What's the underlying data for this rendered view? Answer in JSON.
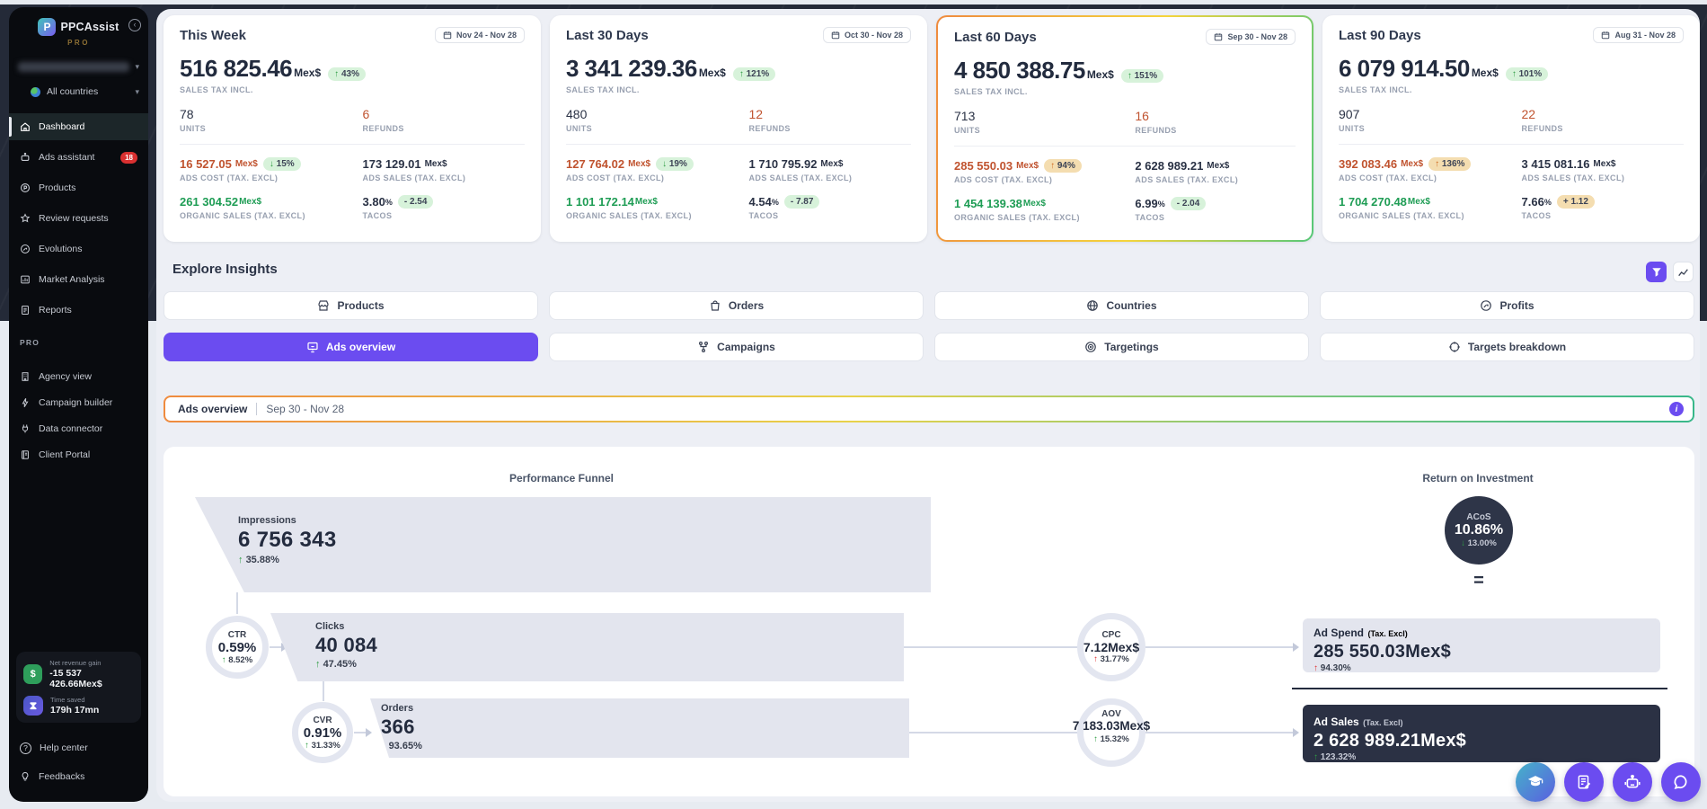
{
  "colors": {
    "accent": "#6b4cf0",
    "good_green": "#2f9e44",
    "bad_red": "#e03131",
    "rust": "#c0532f",
    "green_value": "#1f9d55",
    "dark_navy": "#2b3346",
    "badge_green_bg": "#d7f2da",
    "badge_orange_bg": "#f4ddb0",
    "sidebar_bg": "#090b0f",
    "top_band_bg": "#242a38"
  },
  "sidebar": {
    "brand": "PPCAssist",
    "tier": "PRO",
    "country": "All countries",
    "menu": [
      {
        "label": "Dashboard"
      },
      {
        "label": "Ads assistant",
        "badge": "18"
      },
      {
        "label": "Products"
      },
      {
        "label": "Review requests"
      },
      {
        "label": "Evolutions"
      },
      {
        "label": "Market Analysis"
      },
      {
        "label": "Reports"
      }
    ],
    "section_label": "PRO",
    "pro_menu": [
      {
        "label": "Agency view"
      },
      {
        "label": "Campaign builder"
      },
      {
        "label": "Data connector"
      },
      {
        "label": "Client Portal"
      }
    ],
    "stats": [
      {
        "label": "Net revenue gain",
        "value": "-15 537 426.66Mex$"
      },
      {
        "label": "Time saved",
        "value": "179h 17mn"
      }
    ],
    "footer": [
      {
        "label": "Help center"
      },
      {
        "label": "Feedbacks"
      }
    ]
  },
  "cards": [
    {
      "title": "This Week",
      "range": "Nov 24 - Nov 28",
      "total": {
        "value": "516 825.46",
        "currency": "Mex$",
        "badge_arrow": "↑",
        "badge_text": "43%"
      },
      "total_label": "SALES TAX INCL.",
      "units": {
        "value": "78",
        "label": "UNITS"
      },
      "refunds": {
        "value": "6",
        "label": "REFUNDS"
      },
      "ads_cost": {
        "value": "16 527.05",
        "currency": "Mex$",
        "badge_arrow": "↓",
        "badge_text": "15%",
        "label": "ADS COST (TAX. EXCL)"
      },
      "ads_sales": {
        "value": "173 129.01",
        "currency": "Mex$",
        "label": "ADS SALES (TAX. EXCL)"
      },
      "organic": {
        "value": "261 304.52",
        "currency": "Mex$",
        "label": "ORGANIC SALES (TAX. EXCL)"
      },
      "tacos": {
        "value": "3.80",
        "unit": "%",
        "badge_text": "- 2.54",
        "label": "TACOS"
      }
    },
    {
      "title": "Last 30 Days",
      "range": "Oct 30 - Nov 28",
      "total": {
        "value": "3 341 239.36",
        "currency": "Mex$",
        "badge_arrow": "↑",
        "badge_text": "121%"
      },
      "total_label": "SALES TAX INCL.",
      "units": {
        "value": "480",
        "label": "UNITS"
      },
      "refunds": {
        "value": "12",
        "label": "REFUNDS"
      },
      "ads_cost": {
        "value": "127 764.02",
        "currency": "Mex$",
        "badge_arrow": "↓",
        "badge_text": "19%",
        "label": "ADS COST (TAX. EXCL)"
      },
      "ads_sales": {
        "value": "1 710 795.92",
        "currency": "Mex$",
        "label": "ADS SALES (TAX. EXCL)"
      },
      "organic": {
        "value": "1 101 172.14",
        "currency": "Mex$",
        "label": "ORGANIC SALES (TAX. EXCL)"
      },
      "tacos": {
        "value": "4.54",
        "unit": "%",
        "badge_text": "- 7.87",
        "label": "TACOS"
      }
    },
    {
      "title": "Last 60 Days",
      "range": "Sep 30 - Nov 28",
      "total": {
        "value": "4 850 388.75",
        "currency": "Mex$",
        "badge_arrow": "↑",
        "badge_text": "151%"
      },
      "total_label": "SALES TAX INCL.",
      "units": {
        "value": "713",
        "label": "UNITS"
      },
      "refunds": {
        "value": "16",
        "label": "REFUNDS"
      },
      "ads_cost": {
        "value": "285 550.03",
        "currency": "Mex$",
        "badge_arrow": "↑",
        "badge_text": "94%",
        "label": "ADS COST (TAX. EXCL)"
      },
      "ads_sales": {
        "value": "2 628 989.21",
        "currency": "Mex$",
        "label": "ADS SALES (TAX. EXCL)"
      },
      "organic": {
        "value": "1 454 139.38",
        "currency": "Mex$",
        "label": "ORGANIC SALES (TAX. EXCL)"
      },
      "tacos": {
        "value": "6.99",
        "unit": "%",
        "badge_text": "- 2.04",
        "label": "TACOS"
      }
    },
    {
      "title": "Last 90 Days",
      "range": "Aug 31 - Nov 28",
      "total": {
        "value": "6 079 914.50",
        "currency": "Mex$",
        "badge_arrow": "↑",
        "badge_text": "101%"
      },
      "total_label": "SALES TAX INCL.",
      "units": {
        "value": "907",
        "label": "UNITS"
      },
      "refunds": {
        "value": "22",
        "label": "REFUNDS"
      },
      "ads_cost": {
        "value": "392 083.46",
        "currency": "Mex$",
        "badge_arrow": "↑",
        "badge_text": "136%",
        "label": "ADS COST (TAX. EXCL)"
      },
      "ads_sales": {
        "value": "3 415 081.16",
        "currency": "Mex$",
        "label": "ADS SALES (TAX. EXCL)"
      },
      "organic": {
        "value": "1 704 270.48",
        "currency": "Mex$",
        "label": "ORGANIC SALES (TAX. EXCL)"
      },
      "tacos": {
        "value": "7.66",
        "unit": "%",
        "badge_text": "+ 1.12",
        "label": "TACOS"
      }
    }
  ],
  "insights": {
    "title": "Explore Insights",
    "buttons": [
      {
        "label": "Products"
      },
      {
        "label": "Orders"
      },
      {
        "label": "Countries"
      },
      {
        "label": "Profits"
      },
      {
        "label": "Ads overview"
      },
      {
        "label": "Campaigns"
      },
      {
        "label": "Targetings"
      },
      {
        "label": "Targets breakdown"
      }
    ]
  },
  "overview_bar": {
    "title": "Ads overview",
    "range": "Sep 30 - Nov 28",
    "info": "i"
  },
  "funnel": {
    "left_title": "Performance Funnel",
    "right_title": "Return on Investment",
    "impressions": {
      "label": "Impressions",
      "value": "6 756 343",
      "arrow": "↑",
      "delta": "35.88%"
    },
    "ctr": {
      "label": "CTR",
      "value": "0.59%",
      "arrow": "↑",
      "delta": "8.52%"
    },
    "clicks": {
      "label": "Clicks",
      "value": "40 084",
      "arrow": "↑",
      "delta": "47.45%"
    },
    "cvr": {
      "label": "CVR",
      "value": "0.91%",
      "arrow": "↑",
      "delta": "31.33%"
    },
    "orders": {
      "label": "Orders",
      "value": "366",
      "arrow": "↑",
      "delta": "93.65%"
    },
    "cpc": {
      "label": "CPC",
      "value": "7.12Mex$",
      "arrow": "↑",
      "delta": "31.77%"
    },
    "aov": {
      "label": "AOV",
      "value": "7 183.03Mex$",
      "arrow": "↑",
      "delta": "15.32%"
    },
    "acos": {
      "label": "ACoS",
      "value": "10.86%",
      "arrow": "↓",
      "delta": "13.00%"
    },
    "equals": "=",
    "ad_spend": {
      "label": "Ad Spend",
      "sub": "(Tax. Excl)",
      "value": "285 550.03Mex$",
      "arrow": "↑",
      "delta": "94.30%"
    },
    "ad_sales": {
      "label": "Ad Sales",
      "sub": "(Tax. Excl)",
      "value": "2 628 989.21Mex$",
      "arrow": "↑",
      "delta": "123.32%"
    }
  }
}
